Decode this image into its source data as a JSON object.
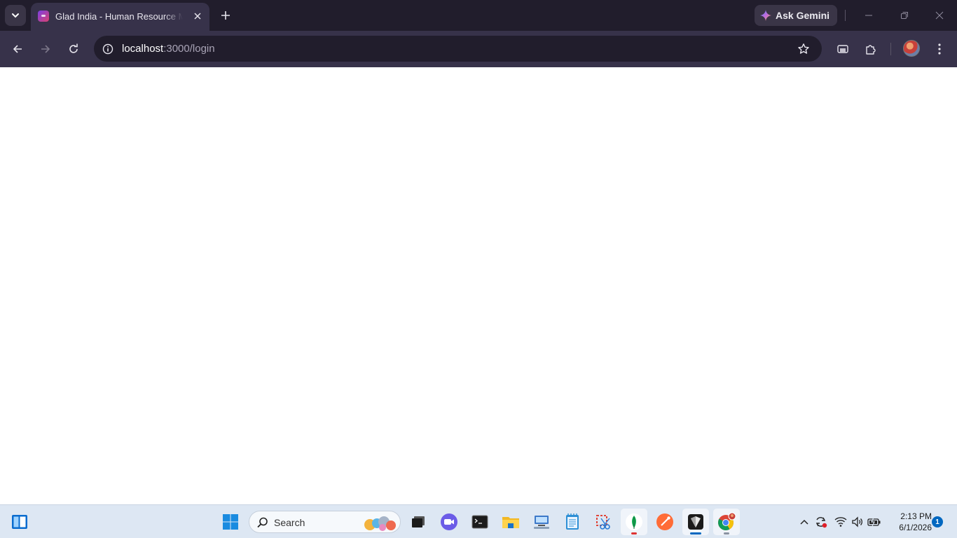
{
  "browser": {
    "tab": {
      "title": "Glad India - Human Resource Management"
    },
    "gemini_label": "Ask Gemini",
    "address": {
      "host": "localhost",
      "path": ":3000/login"
    }
  },
  "taskbar": {
    "search_placeholder": "Search",
    "clock": {
      "time": "2:13 PM",
      "date": "6/1/2026"
    },
    "notification_count": "1",
    "apps": [
      "widgets-icon",
      "start-icon",
      "task-view-icon",
      "zoom-icon",
      "terminal-icon",
      "file-explorer-icon",
      "network-app-icon",
      "notepad-icon",
      "snipping-tool-icon",
      "mongodb-compass-icon",
      "postman-icon",
      "cursor-editor-icon",
      "chrome-icon"
    ]
  },
  "colors": {
    "tab_strip": "#211d2c",
    "toolbar": "#37324a",
    "taskbar": "#dde7f3",
    "accent": "#0067c0"
  }
}
